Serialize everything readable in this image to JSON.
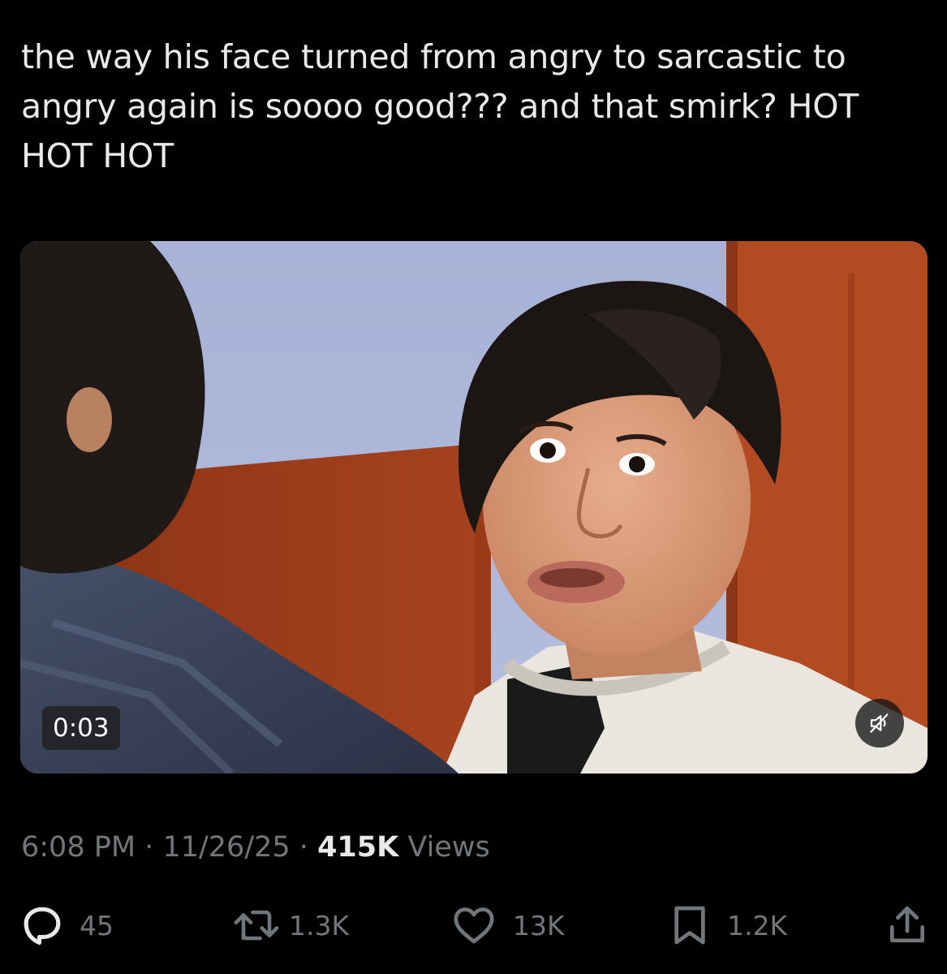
{
  "tweet": {
    "text": "the way his face turned from angry to sarcastic to angry again is soooo good??? and that smirk? HOT HOT HOT"
  },
  "media": {
    "duration": "0:03",
    "mute_icon": "speaker-muted-icon"
  },
  "meta": {
    "time": "6:08 PM",
    "separator": "·",
    "date": "11/26/25",
    "views_count": "415K",
    "views_label": "Views"
  },
  "actions": {
    "reply_count": "45",
    "retweet_count": "1.3K",
    "like_count": "13K",
    "bookmark_count": "1.2K",
    "icons": [
      "reply-icon",
      "retweet-icon",
      "like-icon",
      "bookmark-icon",
      "share-icon"
    ]
  },
  "colors": {
    "background": "#000000",
    "primary_text": "#e7e9ea",
    "secondary_text": "#71767b"
  }
}
